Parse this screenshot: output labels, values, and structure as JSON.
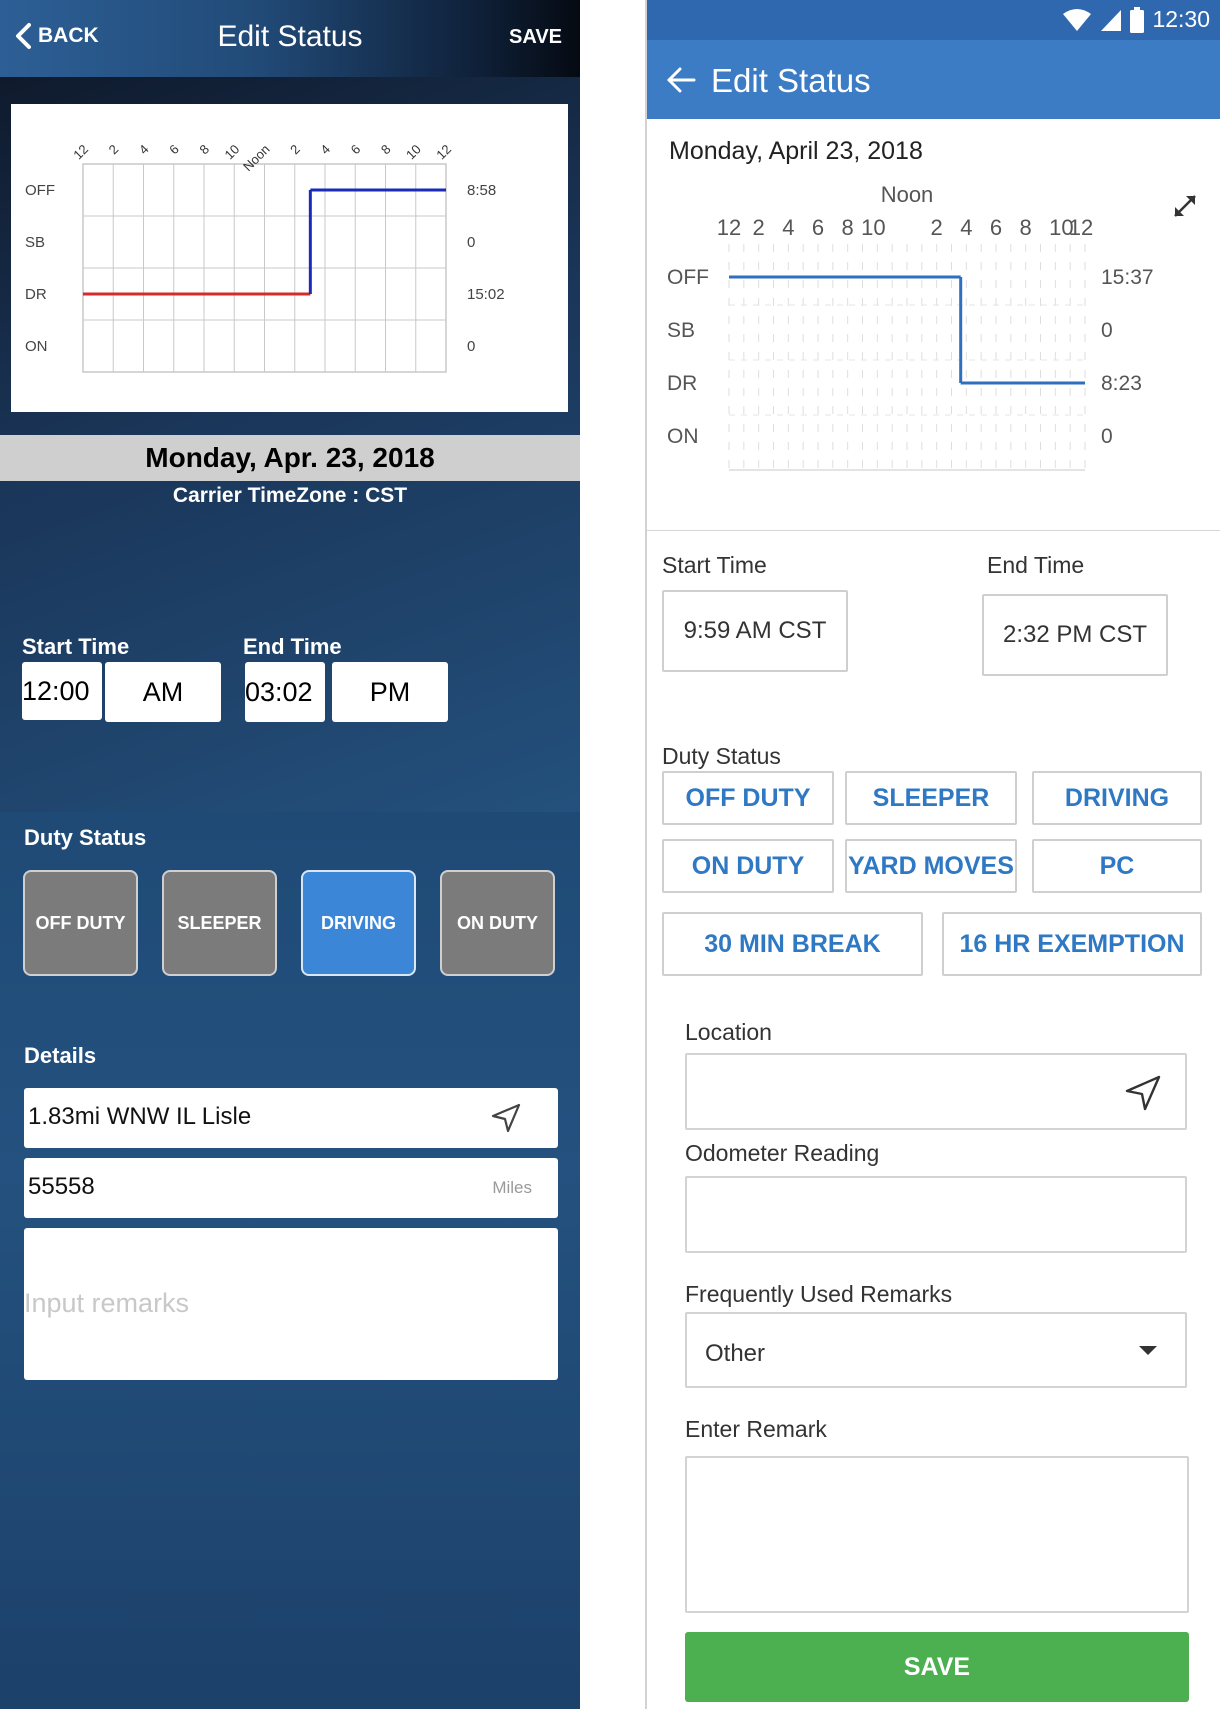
{
  "left": {
    "nav": {
      "back_label": "BACK",
      "title": "Edit Status",
      "save_label": "SAVE"
    },
    "chart_data": {
      "type": "line",
      "title": "",
      "x_ticks": [
        "12",
        "2",
        "4",
        "6",
        "8",
        "10",
        "Noon",
        "2",
        "4",
        "6",
        "8",
        "10",
        "12"
      ],
      "rows": [
        "OFF",
        "SB",
        "DR",
        "ON"
      ],
      "totals": [
        "8:58",
        "0",
        "15:02",
        "0"
      ],
      "series": [
        {
          "segments": [
            {
              "status": "DR",
              "start_hour": 0,
              "end_hour": 15.03,
              "color": "#d62b2b"
            },
            {
              "status": "OFF",
              "start_hour": 15.03,
              "end_hour": 24,
              "color": "#1a2bb8"
            }
          ]
        }
      ]
    },
    "date_text": "Monday, Apr. 23, 2018",
    "timezone_text": "Carrier TimeZone : CST",
    "start_time": {
      "label": "Start Time",
      "time": "12:00",
      "ampm": "AM"
    },
    "end_time": {
      "label": "End Time",
      "time": "03:02",
      "ampm": "PM"
    },
    "duty_status": {
      "label": "Duty Status",
      "buttons": [
        "OFF DUTY",
        "SLEEPER",
        "DRIVING",
        "ON DUTY"
      ],
      "selected": "DRIVING"
    },
    "details": {
      "label": "Details",
      "location": "1.83mi WNW IL Lisle",
      "odometer": "55558",
      "odometer_unit": "Miles",
      "remarks_placeholder": "Input remarks"
    }
  },
  "right": {
    "status_bar": {
      "time": "12:30"
    },
    "appbar": {
      "title": "Edit Status"
    },
    "date_text": "Monday, April 23, 2018",
    "chart_data": {
      "type": "line",
      "title": "",
      "noon_label": "Noon",
      "x_ticks": [
        "12",
        "2",
        "4",
        "6",
        "8",
        "10",
        "",
        "2",
        "4",
        "6",
        "8",
        "10",
        "12"
      ],
      "rows": [
        "OFF",
        "SB",
        "DR",
        "ON"
      ],
      "totals": [
        "15:37",
        "0",
        "8:23",
        "0"
      ],
      "series": [
        {
          "segments": [
            {
              "status": "OFF",
              "start_hour": 0,
              "end_hour": 15.62,
              "color": "#2f6fc0"
            },
            {
              "status": "DR",
              "start_hour": 15.62,
              "end_hour": 24,
              "color": "#2f6fc0"
            }
          ]
        }
      ]
    },
    "start_time": {
      "label": "Start Time",
      "value": "9:59 AM CST"
    },
    "end_time": {
      "label": "End Time",
      "value": "2:32 PM CST"
    },
    "duty_status": {
      "label": "Duty Status",
      "buttons": [
        "OFF DUTY",
        "SLEEPER",
        "DRIVING",
        "ON DUTY",
        "YARD MOVES",
        "PC",
        "30 MIN BREAK",
        "16 HR EXEMPTION"
      ]
    },
    "location": {
      "label": "Location",
      "value": ""
    },
    "odometer": {
      "label": "Odometer Reading",
      "value": ""
    },
    "frequent_remarks": {
      "label": "Frequently Used Remarks",
      "selected": "Other"
    },
    "enter_remark": {
      "label": "Enter Remark",
      "value": ""
    },
    "save_label": "SAVE"
  }
}
